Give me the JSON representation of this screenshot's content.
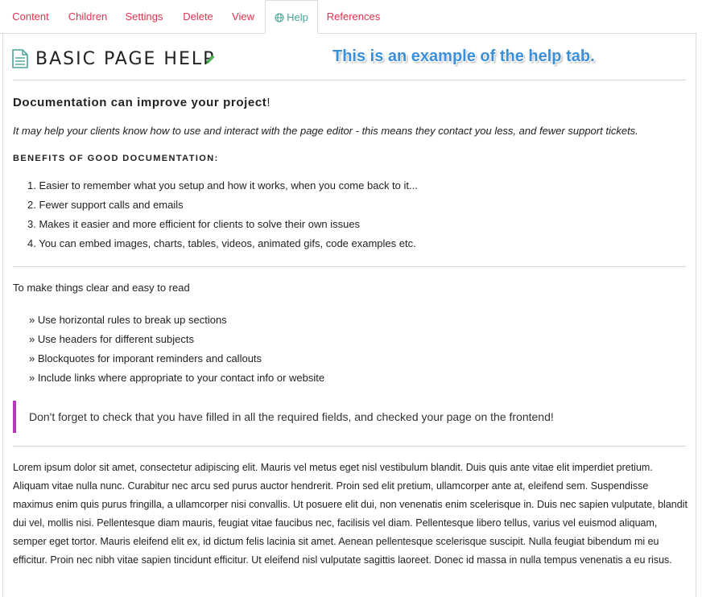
{
  "tabs": [
    {
      "label": "Content"
    },
    {
      "label": "Children"
    },
    {
      "label": "Settings"
    },
    {
      "label": "Delete"
    },
    {
      "label": "View"
    },
    {
      "label": "Help",
      "active": true,
      "icon": "globe-icon"
    },
    {
      "label": "References"
    }
  ],
  "header": {
    "title": "BASIC PAGE HELP",
    "icon": "document-icon",
    "edit_icon": "pencil-icon",
    "callout": "This is an example of the help tab."
  },
  "content": {
    "heading": "Documentation can improve your project",
    "heading_punct": "!",
    "intro": "It may help your clients know how to use and interact with the page editor - this means they contact you less, and fewer support tickets.",
    "benefits_heading": "BENEFITS OF GOOD DOCUMENTATION:",
    "benefits": [
      "1. Easier to remember what you setup and how it works, when you come back to it...",
      "2. Fewer support calls and emails",
      "3. Makes it easier and more efficient for clients to solve their own issues",
      "4. You can embed images, charts, tables, videos, animated gifs, code examples etc."
    ],
    "tips_intro": "To make things clear and easy to read",
    "tips": [
      "» Use horizontal rules to break up sections",
      "» Use headers for different subjects",
      "» Blockquotes for imporant reminders and callouts",
      "» Include links where appropriate to your contact info or website"
    ],
    "blockquote": "Don't forget to check that you have filled in all the required fields, and checked your page on the frontend!",
    "lorem": "Lorem ipsum dolor sit amet, consectetur adipiscing elit. Mauris vel metus eget nisl vestibulum blandit. Duis quis ante vitae elit imperdiet pretium. Aliquam vitae nulla nunc. Curabitur nec arcu sed purus auctor hendrerit. Proin sed elit pretium, ullamcorper ante at, eleifend sem. Suspendisse maximus enim quis purus fringilla, a ullamcorper nisi convallis. Ut posuere elit dui, non venenatis enim scelerisque in. Duis nec sapien vulputate, blandit dui vel, mollis nisi. Pellentesque diam mauris, feugiat vitae faucibus nec, facilisis vel diam. Pellentesque libero tellus, varius vel euismod aliquam, semper eget tortor. Mauris eleifend elit ex, id dictum felis lacinia sit amet. Aenean pellentesque scelerisque suscipit. Nulla feugiat bibendum mi eu efficitur. Proin nec nibh vitae sapien tincidunt efficitur. Ut eleifend nisl vulputate sagittis laoreet. Donec id massa in nulla tempus venenatis a eu risus."
  },
  "colors": {
    "tab_text": "#e0334e",
    "active_tab_text": "#4aa39a",
    "callout": "#3b8fd9",
    "blockquote_border": "#b23ab8",
    "pencil": "#4caf50",
    "doc_icon": "#4aa39a"
  }
}
